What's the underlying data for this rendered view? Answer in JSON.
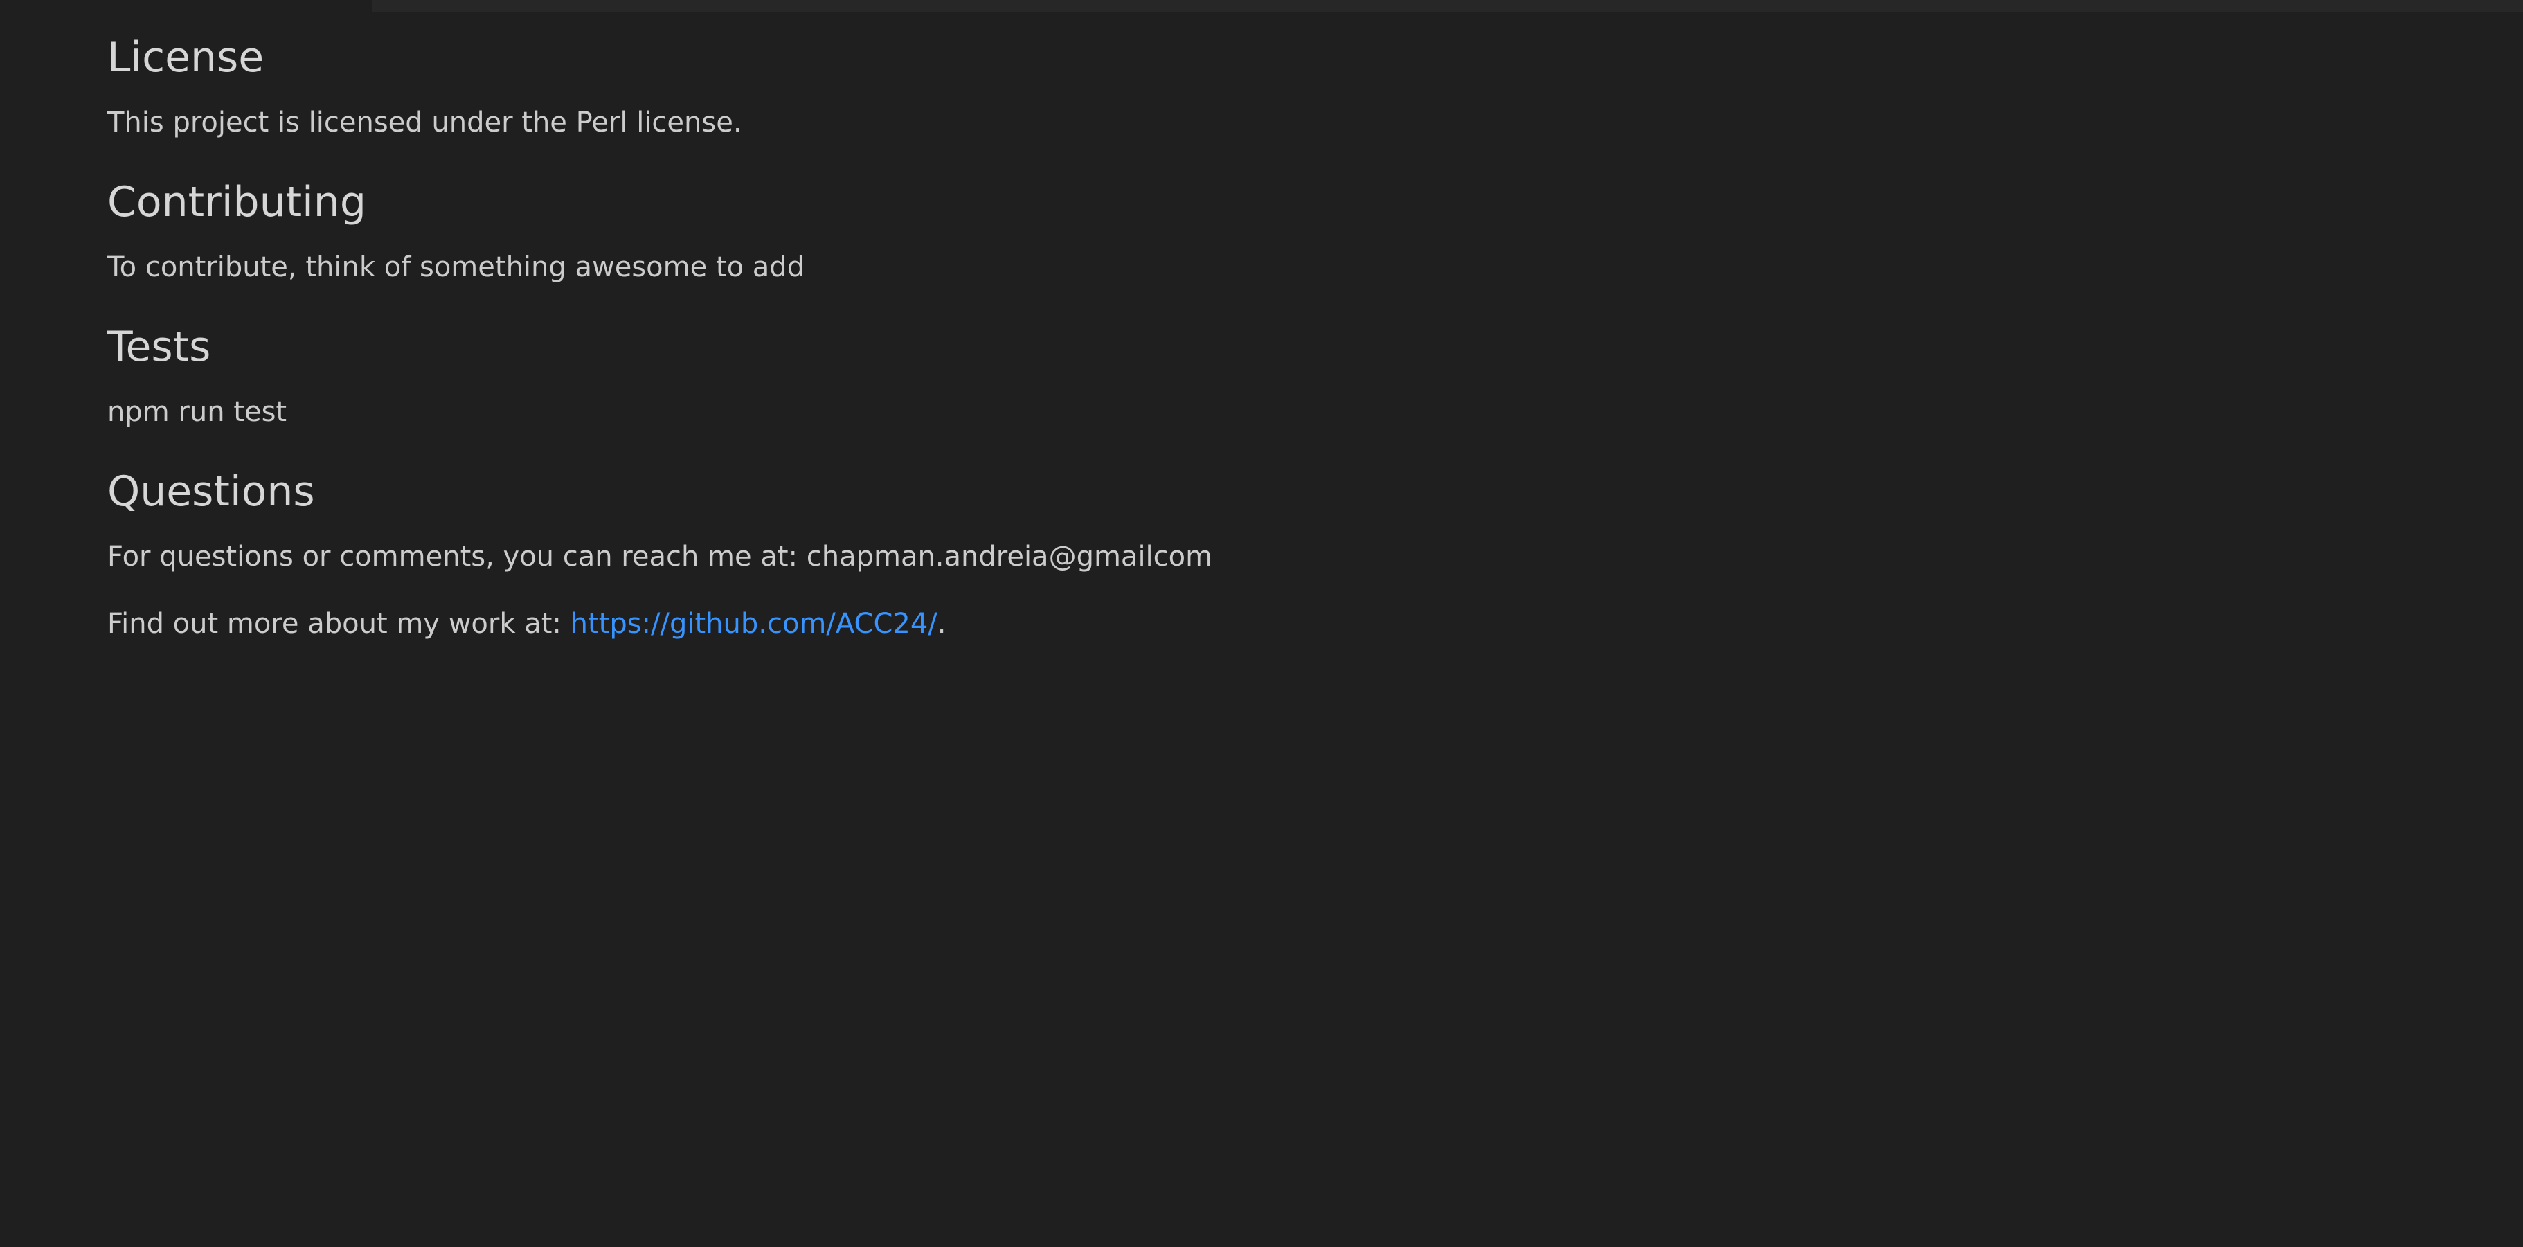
{
  "sections": {
    "license": {
      "heading": "License",
      "text": "This project is licensed under the Perl license."
    },
    "contributing": {
      "heading": "Contributing",
      "text": "To contribute, think of something awesome to add"
    },
    "tests": {
      "heading": "Tests",
      "text": "npm run test"
    },
    "questions": {
      "heading": "Questions",
      "contact_text": "For questions or comments, you can reach me at: chapman.andreia@gmailcom",
      "more_prefix": "Find out more about my work at: ",
      "link_text": "https://github.com/ACC24/",
      "link_href": "https://github.com/ACC24/",
      "more_suffix": "."
    }
  },
  "colors": {
    "background": "#1f1f1f",
    "text": "#cccccc",
    "link": "#3794ff"
  }
}
